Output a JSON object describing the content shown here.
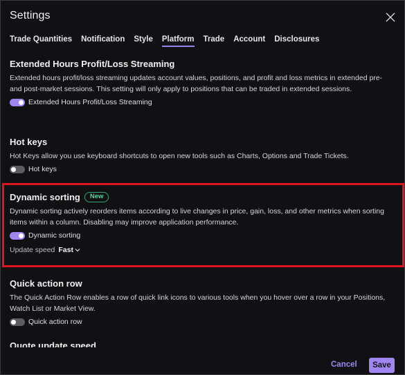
{
  "dialog": {
    "title": "Settings"
  },
  "tabs": [
    {
      "label": "Trade Quantities"
    },
    {
      "label": "Notification"
    },
    {
      "label": "Style"
    },
    {
      "label": "Platform"
    },
    {
      "label": "Trade"
    },
    {
      "label": "Account"
    },
    {
      "label": "Disclosures"
    }
  ],
  "active_tab": "Platform",
  "sections": {
    "extended": {
      "title": "Extended Hours Profit/Loss Streaming",
      "description": "Extended hours profit/loss streaming updates account values, positions, and profit and loss metrics in extended pre- and post-market sessions. This setting will only apply to positions that can be traded in extended sessions.",
      "toggle_label": "Extended Hours Profit/Loss Streaming",
      "toggle_on": true
    },
    "hotkeys": {
      "title": "Hot keys",
      "description": "Hot Keys allow you use keyboard shortcuts to open new tools such as Charts, Options and Trade Tickets.",
      "toggle_label": "Hot keys",
      "toggle_on": false
    },
    "dynamic": {
      "title": "Dynamic sorting",
      "badge": "New",
      "description": "Dynamic sorting actively reorders items according to live changes in price, gain, loss, and other metrics when sorting items within a column. Disabling may improve application performance.",
      "toggle_label": "Dynamic sorting",
      "toggle_on": true,
      "speed_label": "Update speed",
      "speed_value": "Fast"
    },
    "quickaction": {
      "title": "Quick action row",
      "description": "The Quick Action Row enables a row of quick link icons to various tools when you hover over a row in your Positions, Watch List or Market View.",
      "toggle_label": "Quick action row",
      "toggle_on": false
    },
    "quote": {
      "title": "Quote update speed"
    }
  },
  "footer": {
    "cancel_label": "Cancel",
    "save_label": "Save"
  },
  "colors": {
    "background": "#111114",
    "accent": "#9f86f0",
    "badge": "#52d49b",
    "highlight": "#e0141e"
  }
}
